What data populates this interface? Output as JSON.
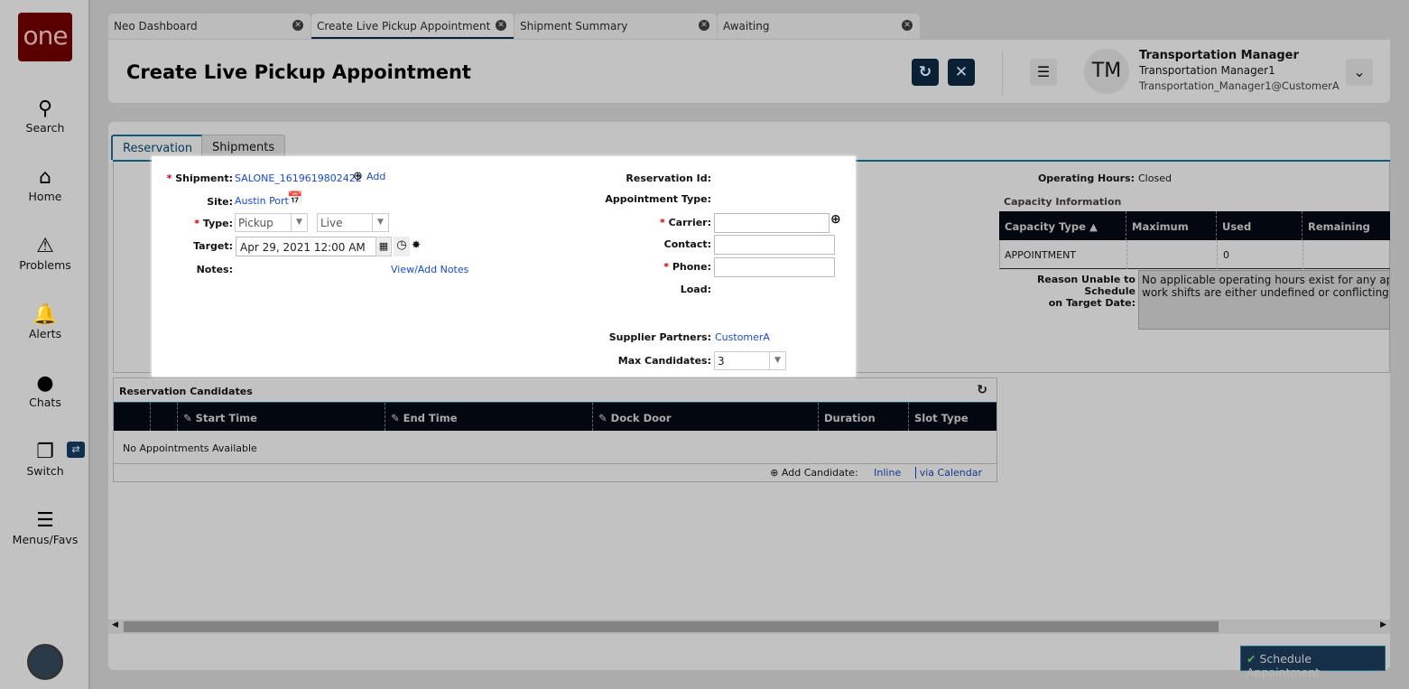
{
  "sidebar": {
    "logo": "one",
    "items": [
      {
        "label": "Search",
        "icon": "search-icon"
      },
      {
        "label": "Home",
        "icon": "home-icon"
      },
      {
        "label": "Problems",
        "icon": "warning-icon"
      },
      {
        "label": "Alerts",
        "icon": "bell-icon"
      },
      {
        "label": "Chats",
        "icon": "chat-icon"
      },
      {
        "label": "Switch",
        "icon": "switch-icon"
      },
      {
        "label": "Menus/Favs",
        "icon": "menu-icon"
      }
    ]
  },
  "tabs": [
    {
      "label": "Neo Dashboard"
    },
    {
      "label": "Create Live Pickup Appointment"
    },
    {
      "label": "Shipment Summary"
    },
    {
      "label": "Awaiting"
    }
  ],
  "header": {
    "title": "Create Live Pickup Appointment",
    "user": {
      "initials": "TM",
      "role": "Transportation Manager",
      "name": "Transportation Manager1",
      "email": "Transportation_Manager1@CustomerA"
    }
  },
  "page_tabs": [
    "Reservation",
    "Shipments"
  ],
  "form": {
    "shipment_label": "Shipment:",
    "shipment_value": "SALONE_1619619802422",
    "add_label": "Add",
    "site_label": "Site:",
    "site_value": "Austin Port",
    "type_label": "Type:",
    "type_value": "Pickup",
    "subtype_value": "Live",
    "target_label": "Target:",
    "target_value": "Apr 29, 2021 12:00 AM",
    "notes_label": "Notes:",
    "notes_link": "View/Add Notes",
    "reservation_id_label": "Reservation Id:",
    "appointment_type_label": "Appointment Type:",
    "carrier_label": "Carrier:",
    "carrier_value": "",
    "contact_label": "Contact:",
    "contact_value": "",
    "phone_label": "Phone:",
    "phone_value": "",
    "load_label": "Load:",
    "supplier_label": "Supplier Partners:",
    "supplier_value": "CustomerA",
    "max_candidates_label": "Max Candidates:",
    "max_candidates_value": "3"
  },
  "capacity": {
    "operating_hours_label": "Operating Hours:",
    "operating_hours_value": "Closed",
    "title": "Capacity Information",
    "columns": [
      "Capacity Type",
      "Maximum",
      "Used",
      "Remaining"
    ],
    "rows": [
      [
        "APPOINTMENT",
        "",
        "0",
        ""
      ]
    ],
    "reason_label_1": "Reason Unable to Schedule",
    "reason_label_2": "on Target Date:",
    "reason_text": "No applicable operating hours exist for any applic work shifts are either undefined or conflicting for"
  },
  "candidates": {
    "title": "Reservation Candidates",
    "columns": [
      "Start Time",
      "End Time",
      "Dock Door",
      "Duration",
      "Slot Type"
    ],
    "empty": "No Appointments Available",
    "add_label": "Add Candidate:",
    "inline": "Inline",
    "via_calendar": "via Calendar"
  },
  "footer": {
    "schedule_button": "Schedule Appointment"
  }
}
